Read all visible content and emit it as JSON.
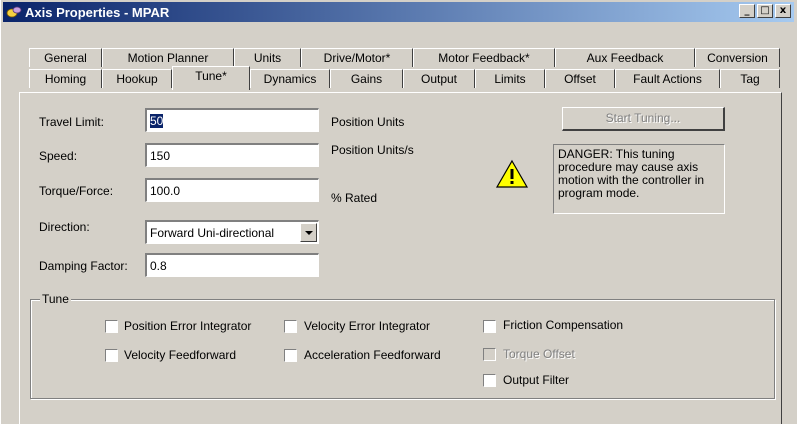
{
  "window": {
    "title": "Axis Properties - MPAR",
    "buttons": {
      "minimize": "_",
      "maximize": "□",
      "close": "x"
    }
  },
  "tabs_row1": [
    "General",
    "Motion Planner",
    "Units",
    "Drive/Motor*",
    "Motor Feedback*",
    "Aux Feedback",
    "Conversion"
  ],
  "tabs_row2": [
    "Homing",
    "Hookup",
    "Tune*",
    "Dynamics",
    "Gains",
    "Output",
    "Limits",
    "Offset",
    "Fault Actions",
    "Tag"
  ],
  "active_tab": "Tune*",
  "form": {
    "travel_limit": {
      "label": "Travel Limit:",
      "value": "50",
      "unit": "Position Units"
    },
    "speed": {
      "label": "Speed:",
      "value": "150",
      "unit": "Position Units/s"
    },
    "torque": {
      "label": "Torque/Force:",
      "value": "100.0",
      "unit": "% Rated"
    },
    "direction": {
      "label": "Direction:",
      "value": "Forward Uni-directional"
    },
    "damping": {
      "label": "Damping Factor:",
      "value": "0.8"
    }
  },
  "start_tuning": {
    "label": "Start Tuning..."
  },
  "warning": {
    "text": "DANGER: This tuning procedure may cause axis motion with the controller in program mode.",
    "icon": "warning-icon"
  },
  "tune_group": {
    "label": "Tune",
    "options": {
      "position_error_integrator": "Position Error Integrator",
      "velocity_error_integrator": "Velocity Error Integrator",
      "friction_compensation": "Friction Compensation",
      "velocity_feedforward": "Velocity Feedforward",
      "acceleration_feedforward": "Acceleration Feedforward",
      "torque_offset": "Torque Offset",
      "output_filter": "Output Filter"
    }
  }
}
